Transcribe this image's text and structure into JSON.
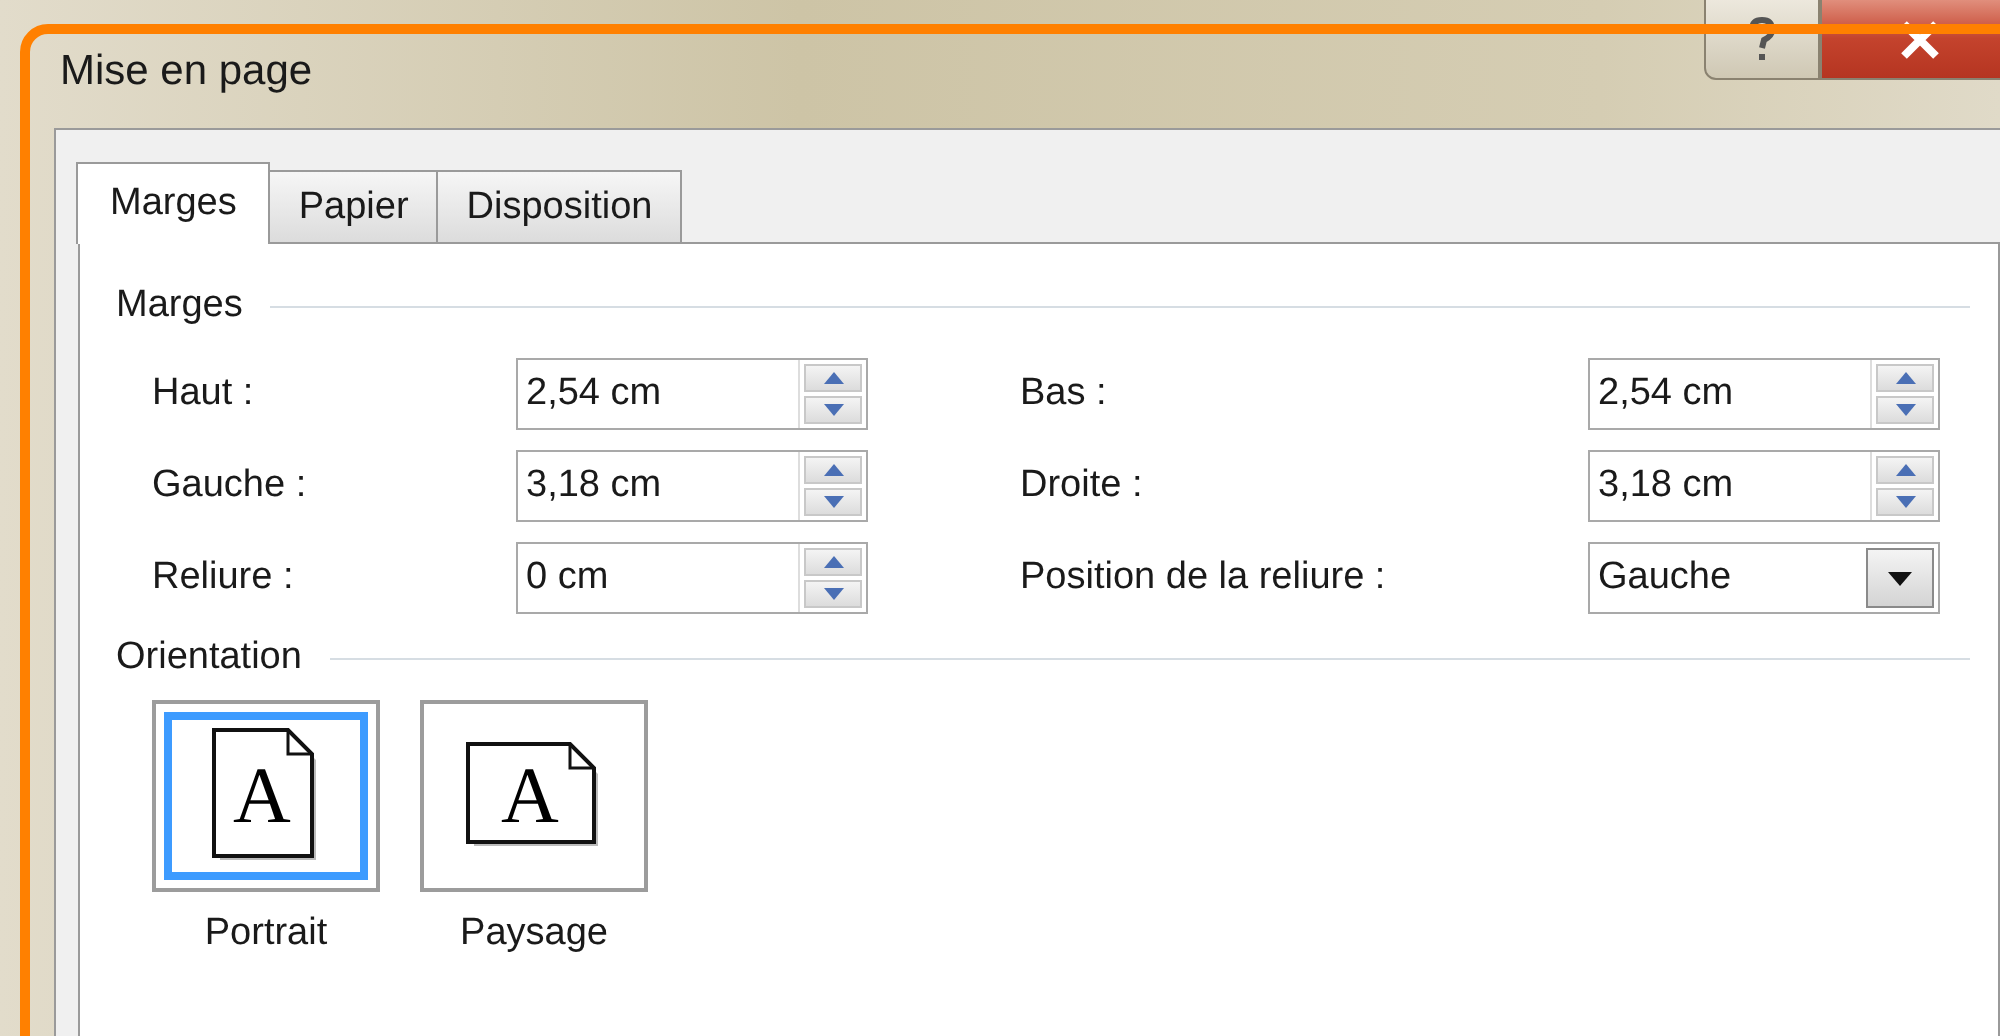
{
  "window": {
    "title": "Mise en page"
  },
  "tabs": [
    {
      "label": "Marges",
      "selected": true
    },
    {
      "label": "Papier",
      "selected": false
    },
    {
      "label": "Disposition",
      "selected": false
    }
  ],
  "margins": {
    "heading": "Marges",
    "fields": [
      {
        "label": "Haut :",
        "value": "2,54 cm",
        "kind": "spin"
      },
      {
        "label": "Bas :",
        "value": "2,54 cm",
        "kind": "spin"
      },
      {
        "label": "Gauche :",
        "value": "3,18 cm",
        "kind": "spin"
      },
      {
        "label": "Droite :",
        "value": "3,18 cm",
        "kind": "spin"
      },
      {
        "label": "Reliure :",
        "value": "0 cm",
        "kind": "spin"
      },
      {
        "label": "Position de la reliure :",
        "value": "Gauche",
        "kind": "dropdown"
      }
    ]
  },
  "orientation": {
    "heading": "Orientation",
    "options": [
      {
        "label": "Portrait",
        "glyph": "A",
        "kind": "portrait",
        "selected": true
      },
      {
        "label": "Paysage",
        "glyph": "A",
        "kind": "landscape",
        "selected": false
      }
    ]
  }
}
